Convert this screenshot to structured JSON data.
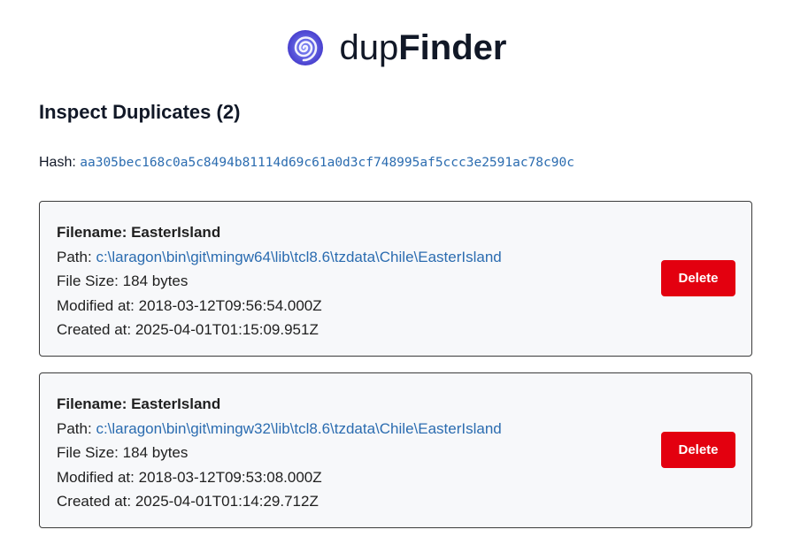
{
  "header": {
    "logo_icon": "spiral-logo-icon",
    "brand_light": "dup",
    "brand_bold": "Finder",
    "logo_color": "#4f46e5"
  },
  "page": {
    "title": "Inspect Duplicates (2)"
  },
  "hash": {
    "label": "Hash:",
    "value": "aa305bec168c0a5c8494b81114d69c61a0d3cf748995af5ccc3e2591ac78c90c"
  },
  "files": [
    {
      "filename_label": "Filename:",
      "filename": "EasterIsland",
      "path_label": "Path:",
      "path": "c:\\laragon\\bin\\git\\mingw64\\lib\\tcl8.6\\tzdata\\Chile\\EasterIsland",
      "size_label": "File Size:",
      "size": "184 bytes",
      "modified_label": "Modified at:",
      "modified": "2018-03-12T09:56:54.000Z",
      "created_label": "Created at:",
      "created": "2025-04-01T01:15:09.951Z",
      "delete_label": "Delete"
    },
    {
      "filename_label": "Filename:",
      "filename": "EasterIsland",
      "path_label": "Path:",
      "path": "c:\\laragon\\bin\\git\\mingw32\\lib\\tcl8.6\\tzdata\\Chile\\EasterIsland",
      "size_label": "File Size:",
      "size": "184 bytes",
      "modified_label": "Modified at:",
      "modified": "2018-03-12T09:53:08.000Z",
      "created_label": "Created at:",
      "created": "2025-04-01T01:14:29.712Z",
      "delete_label": "Delete"
    }
  ],
  "colors": {
    "link": "#2b6cb0",
    "danger": "#e3000f",
    "card_bg": "#f7f8fa"
  }
}
